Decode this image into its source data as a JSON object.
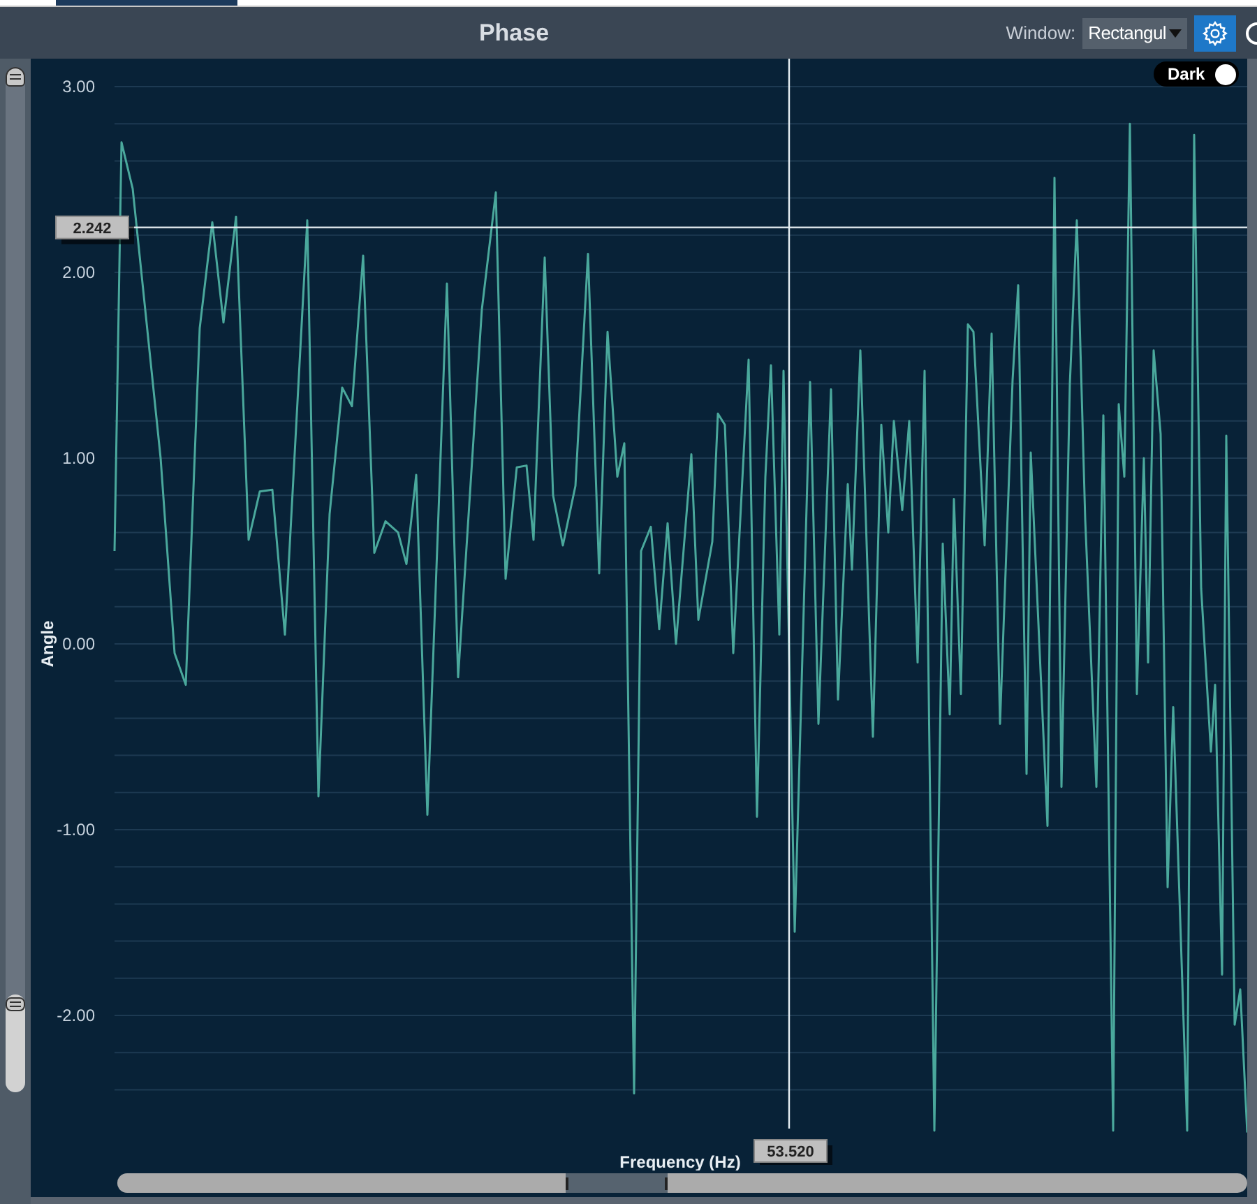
{
  "title": "Phase",
  "window_select": {
    "label": "Window:",
    "value": "Rectangul"
  },
  "dark_toggle": {
    "label": "Dark",
    "on": true
  },
  "plot": {
    "y_axis_title": "Angle",
    "x_axis_title": "Frequency (Hz)",
    "y_tick_labels": [
      "3.00",
      "2.00",
      "1.00",
      "0.00",
      "-1.00",
      "-2.00"
    ],
    "cursor_y_label": "2.242",
    "cursor_x_label": "53.520"
  }
}
